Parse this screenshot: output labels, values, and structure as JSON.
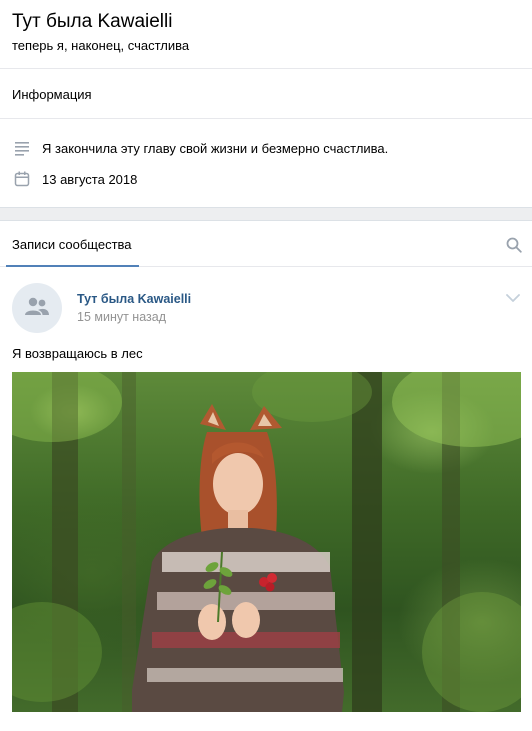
{
  "group": {
    "title": "Тут была Kawaielli",
    "status": "теперь я, наконец, счастлива"
  },
  "info": {
    "heading": "Информация",
    "description": "Я закончила эту главу свой жизни и безмерно счастлива.",
    "date": "13 августа 2018"
  },
  "tabs": {
    "active_label": "Записи сообщества"
  },
  "post": {
    "author": "Тут была Kawaielli",
    "time": "15 минут назад",
    "text": "Я возвращаюсь в лес"
  },
  "colors": {
    "link": "#2a5885",
    "accent": "#5181b8",
    "muted": "#939393",
    "separator": "#edeef0"
  },
  "icons": [
    "lines-icon",
    "calendar-icon",
    "search-icon",
    "group-avatar-icon",
    "chevron-down-icon"
  ]
}
